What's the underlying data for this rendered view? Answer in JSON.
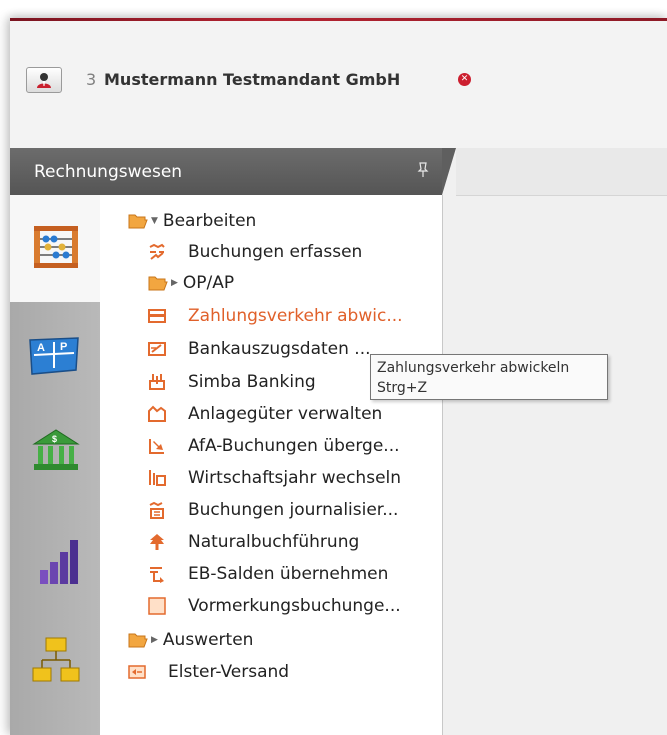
{
  "header": {
    "mandant_number": "3",
    "mandant_name": "Mustermann Testmandant GmbH",
    "close_symbol": "✕"
  },
  "panel": {
    "title": "Rechnungswesen",
    "pin_icon": "pin-icon"
  },
  "sidebar_icons": [
    "abacus-icon",
    "ap-ledger-icon",
    "bank-icon",
    "bar-chart-icon",
    "org-chart-icon"
  ],
  "tree": {
    "groups": [
      {
        "label": "Bearbeiten",
        "icon": "folder-open-icon",
        "expanded": true
      },
      {
        "label": "OP/AP",
        "icon": "folder-open-icon",
        "expanded": false
      },
      {
        "label": "Auswerten",
        "icon": "folder-open-icon",
        "expanded": false
      }
    ],
    "items": [
      {
        "label": "Buchungen erfassen",
        "icon": "booking-entry-icon"
      },
      {
        "label": "Zahlungsverkehr abwic...",
        "icon": "payment-card-icon",
        "active": true
      },
      {
        "label": "Bankauszugsdaten ...",
        "icon": "bank-statement-icon"
      },
      {
        "label": "Simba Banking",
        "icon": "simba-banking-icon"
      },
      {
        "label": "Anlagegüter verwalten",
        "icon": "assets-icon"
      },
      {
        "label": "AfA-Buchungen überge...",
        "icon": "depreciation-icon"
      },
      {
        "label": "Wirtschaftsjahr wechseln",
        "icon": "fiscal-year-icon"
      },
      {
        "label": "Buchungen journalisier...",
        "icon": "journal-icon"
      },
      {
        "label": "Naturalbuchführung",
        "icon": "tree-icon"
      },
      {
        "label": "EB-Salden übernehmen",
        "icon": "balance-transfer-icon"
      },
      {
        "label": "Vormerkungsbuchunge...",
        "icon": "reserved-booking-icon"
      },
      {
        "label": "Elster-Versand",
        "icon": "elster-icon"
      }
    ]
  },
  "tooltip": {
    "title": "Zahlungsverkehr abwickeln",
    "shortcut": "Strg+Z"
  },
  "colors": {
    "accent": "#b52331",
    "active_text": "#e0602a",
    "icon_orange": "#e36a2e"
  }
}
